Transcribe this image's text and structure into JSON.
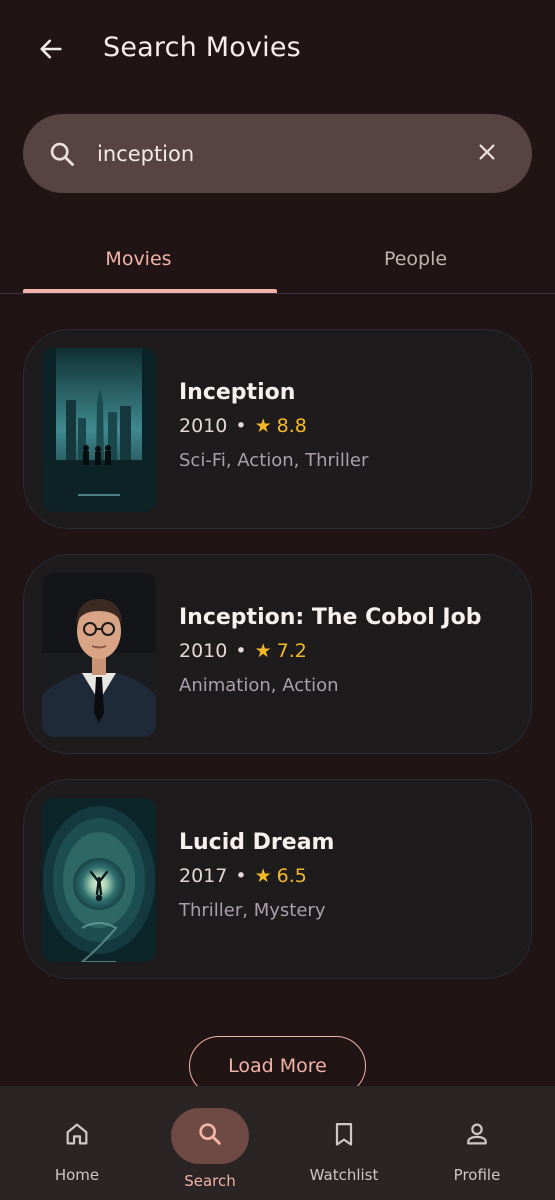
{
  "header": {
    "title": "Search Movies"
  },
  "search": {
    "value": "inception",
    "placeholder": ""
  },
  "tabs": [
    {
      "label": "Movies",
      "active": true
    },
    {
      "label": "People",
      "active": false
    }
  ],
  "results": [
    {
      "title": "Inception",
      "year": "2010",
      "rating": "8.8",
      "genres": "Sci-Fi, Action, Thriller",
      "poster_icon": "city-silhouette-poster"
    },
    {
      "title": "Inception: The Cobol Job",
      "year": "2010",
      "rating": "7.2",
      "genres": "Animation, Action",
      "poster_icon": "man-portrait-poster"
    },
    {
      "title": "Lucid Dream",
      "year": "2017",
      "rating": "6.5",
      "genres": "Thriller, Mystery",
      "poster_icon": "falling-figure-tunnel-poster"
    }
  ],
  "load_more_label": "Load More",
  "nav": [
    {
      "label": "Home",
      "icon": "home-icon",
      "active": false
    },
    {
      "label": "Search",
      "icon": "search-icon",
      "active": true
    },
    {
      "label": "Watchlist",
      "icon": "bookmark-icon",
      "active": false
    },
    {
      "label": "Profile",
      "icon": "person-icon",
      "active": false
    }
  ],
  "colors": {
    "background": "#201414",
    "accent": "#f2b3a9",
    "star": "#f5b82b",
    "card": "#1d1b1b",
    "search_bar": "#574442"
  },
  "separator": "•"
}
